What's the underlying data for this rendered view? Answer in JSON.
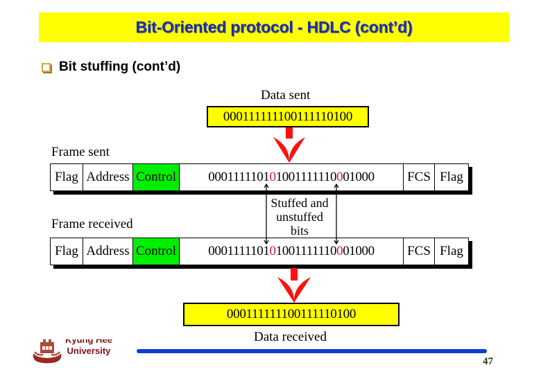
{
  "slide": {
    "title": "Bit-Oriented protocol - HDLC (cont’d)",
    "bullet": "Bit stuffing (cont’d)",
    "page_number": "47",
    "footer": {
      "university_line1": "Kyung Hee",
      "university_line2": "University",
      "logo_icon": "university-crest-icon"
    }
  },
  "diagram": {
    "data_sent_label": "Data sent",
    "data_sent_bits": "000111111100111110100",
    "frame_sent_label": "Frame sent",
    "frame_received_label": "Frame received",
    "frame_fields": {
      "flag": "Flag",
      "address": "Address",
      "control": "Control",
      "fcs": "FCS",
      "flag_end": "Flag"
    },
    "stuffed_payload": {
      "part1": "0001111101",
      "stuffed_bit_1": "0",
      "part2": "1001111110",
      "stuffed_bit_2": "0",
      "part3": "01000"
    },
    "stuffed_note": {
      "line1": "Stuffed and",
      "line2": "unstuffed",
      "line3": "bits"
    },
    "data_received_bits": "000111111100111110100",
    "data_received_label": "Data received",
    "colors": {
      "data_box": "#ffff00",
      "control_field": "#00ee00",
      "arrow": "#ff1010",
      "stuffed_bit": "#d0202a"
    }
  }
}
